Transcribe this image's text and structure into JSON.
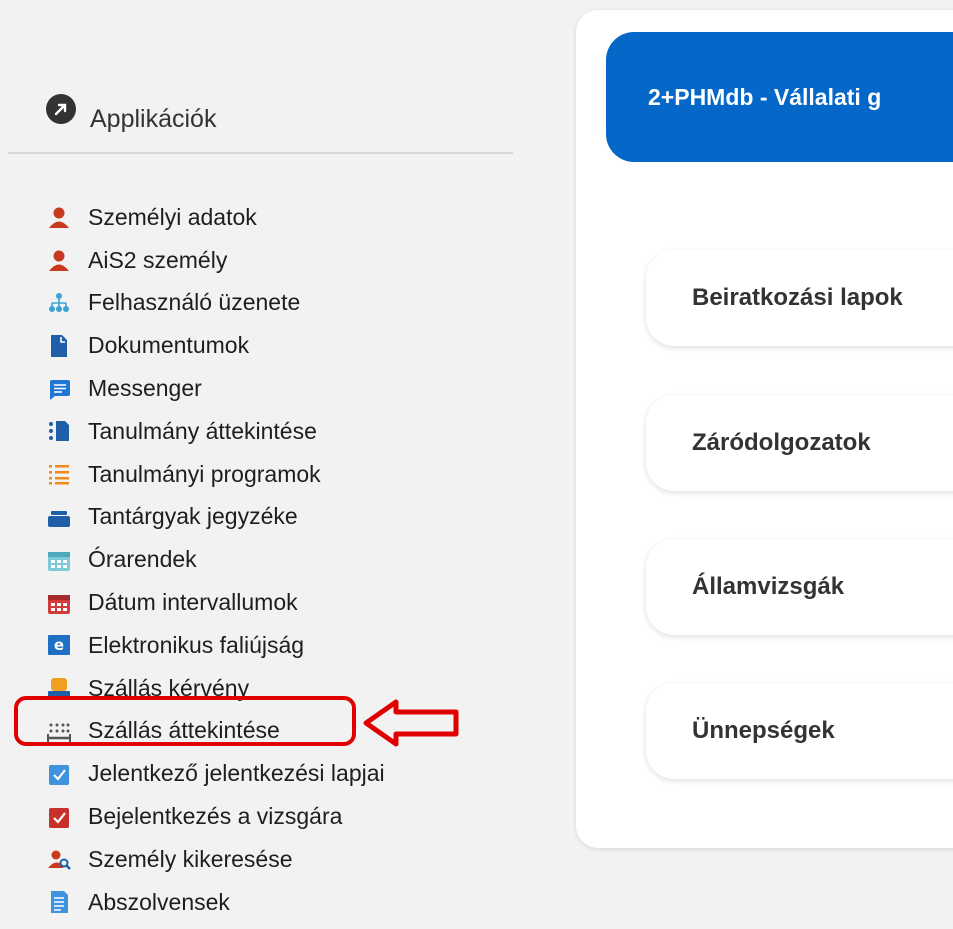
{
  "sidebar": {
    "title": "Applikációk",
    "items": [
      {
        "label": "Személyi adatok",
        "icon": "person-red-icon"
      },
      {
        "label": "AiS2 személy",
        "icon": "person-red-icon"
      },
      {
        "label": "Felhasználó üzenete",
        "icon": "org-chart-icon"
      },
      {
        "label": "Dokumentumok",
        "icon": "document-icon"
      },
      {
        "label": "Messenger",
        "icon": "chat-icon"
      },
      {
        "label": "Tanulmány áttekintése",
        "icon": "study-overview-icon"
      },
      {
        "label": "Tanulmányi programok",
        "icon": "list-icon"
      },
      {
        "label": "Tantárgyak jegyzéke",
        "icon": "stack-icon"
      },
      {
        "label": "Órarendek",
        "icon": "calendar-icon"
      },
      {
        "label": "Dátum intervallumok",
        "icon": "calendar-red-icon"
      },
      {
        "label": "Elektronikus faliújság",
        "icon": "e-board-icon"
      },
      {
        "label": "Szállás kérvény",
        "icon": "accommodation-request-icon"
      },
      {
        "label": "Szállás áttekintése",
        "icon": "bed-icon"
      },
      {
        "label": "Jelentkező jelentkezési lapjai",
        "icon": "checkbox-blue-icon"
      },
      {
        "label": "Bejelentkezés a vizsgára",
        "icon": "checkbox-red-icon"
      },
      {
        "label": "Személy kikeresése",
        "icon": "person-search-icon"
      },
      {
        "label": "Abszolvensek",
        "icon": "page-icon"
      }
    ],
    "highlighted_index": 12
  },
  "main": {
    "banner": "2+PHMdb - Vállalati g",
    "cards": [
      "Beiratkozási lapok",
      "Záródolgozatok",
      "Államvizsgák",
      "Ünnepségek"
    ]
  },
  "colors": {
    "accent": "#0567c8",
    "annotation": "#e00000"
  }
}
